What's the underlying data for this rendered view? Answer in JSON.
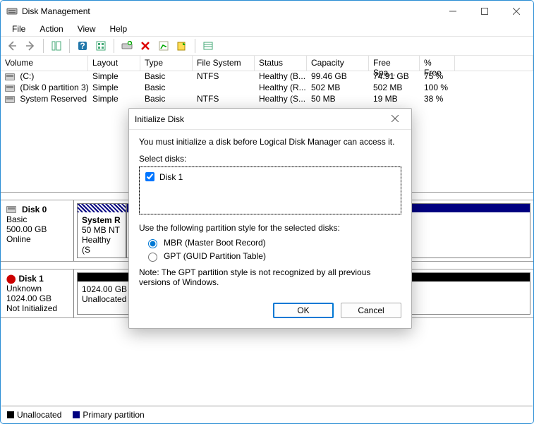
{
  "window": {
    "title": "Disk Management"
  },
  "menu": {
    "file": "File",
    "action": "Action",
    "view": "View",
    "help": "Help"
  },
  "columns": {
    "volume": "Volume",
    "layout": "Layout",
    "type": "Type",
    "fs": "File System",
    "status": "Status",
    "capacity": "Capacity",
    "free": "Free Spa...",
    "pct": "% Free"
  },
  "volumes": [
    {
      "name": " (C:)",
      "layout": "Simple",
      "type": "Basic",
      "fs": "NTFS",
      "status": "Healthy (B...",
      "cap": "99.46 GB",
      "free": "74.91 GB",
      "pct": "75 %"
    },
    {
      "name": " (Disk 0 partition 3)",
      "layout": "Simple",
      "type": "Basic",
      "fs": "",
      "status": "Healthy (R...",
      "cap": "502 MB",
      "free": "502 MB",
      "pct": "100 %"
    },
    {
      "name": " System Reserved",
      "layout": "Simple",
      "type": "Basic",
      "fs": "NTFS",
      "status": "Healthy (S...",
      "cap": "50 MB",
      "free": "19 MB",
      "pct": "38 %"
    }
  ],
  "disk0": {
    "name": "Disk 0",
    "type": "Basic",
    "size": "500.00 GB",
    "state": "Online",
    "part0": {
      "title": "System R",
      "line2": "50 MB NT",
      "line3": "Healthy (S"
    }
  },
  "disk1": {
    "name": "Disk 1",
    "type": "Unknown",
    "size": "1024.00 GB",
    "state": "Not Initialized",
    "part0": {
      "line1": "1024.00 GB",
      "line2": "Unallocated"
    }
  },
  "legend": {
    "unalloc": "Unallocated",
    "primary": "Primary partition"
  },
  "dialog": {
    "title": "Initialize Disk",
    "intro": "You must initialize a disk before Logical Disk Manager can access it.",
    "select_label": "Select disks:",
    "disk_item": "Disk 1",
    "style_label": "Use the following partition style for the selected disks:",
    "mbr": "MBR (Master Boot Record)",
    "gpt": "GPT (GUID Partition Table)",
    "note": "Note: The GPT partition style is not recognized by all previous versions of Windows.",
    "ok": "OK",
    "cancel": "Cancel"
  }
}
